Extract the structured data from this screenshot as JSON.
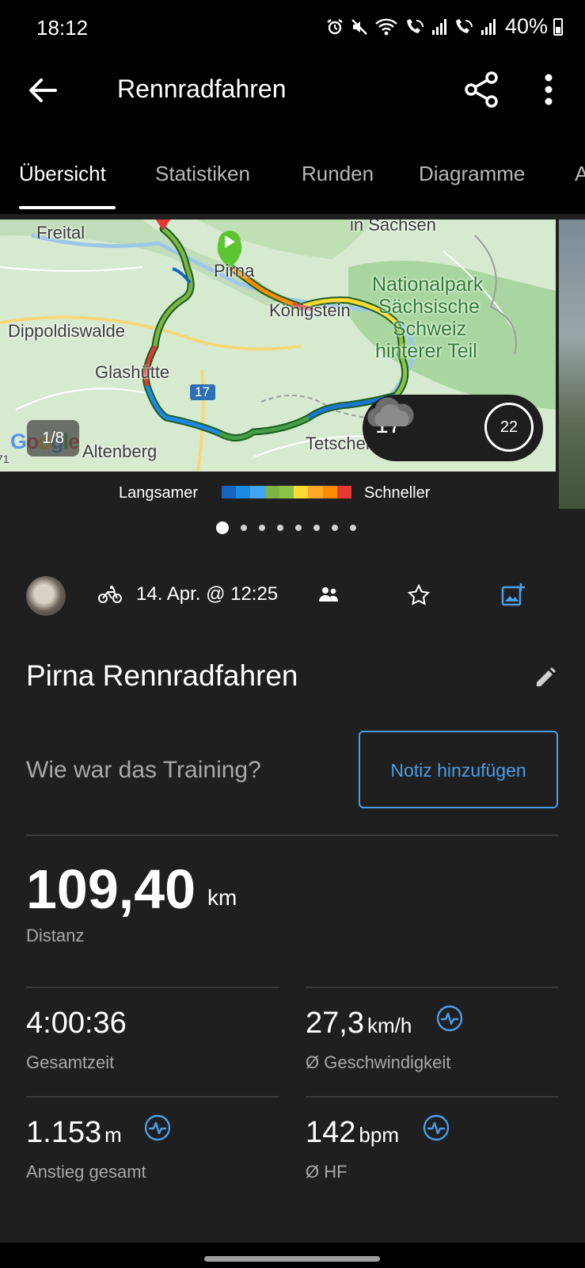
{
  "status_bar": {
    "time": "18:12",
    "battery": "40%"
  },
  "app_bar": {
    "title": "Rennradfahren"
  },
  "tabs": [
    {
      "label": "Übersicht",
      "active": true
    },
    {
      "label": "Statistiken"
    },
    {
      "label": "Runden"
    },
    {
      "label": "Diagramme"
    },
    {
      "label": "A"
    }
  ],
  "map": {
    "places": {
      "freital": "Freital",
      "sachsen": "in Sachsen",
      "pirna": "Pirna",
      "nationalpark": "Nationalpark",
      "saechsische": "Sächsische",
      "schweiz": "Schweiz",
      "hinterer": "hinterer Teil",
      "koenigstein": "Königstein",
      "dippoldiswalde": "Dippoldiswalde",
      "glashuette": "Glashütte",
      "altenberg": "Altenberg",
      "tetschen": "Tetschen",
      "route_number": "17",
      "edge_number": "71"
    },
    "google": "Google",
    "photo_counter": "1/8",
    "weather": {
      "temperature": "17°",
      "condition_icon": "cloud-icon",
      "wind": "22"
    },
    "legend": {
      "slower": "Langsamer",
      "faster": "Schneller",
      "colors": [
        "#1565c0",
        "#1e88e5",
        "#42a5f5",
        "#7cb342",
        "#8bc34a",
        "#fdd835",
        "#ffa726",
        "#fb8c00",
        "#e53935"
      ]
    }
  },
  "pager": {
    "count": 8,
    "active": 0
  },
  "activity": {
    "type_icon": "bike-icon",
    "date": "14. Apr. @ 12:25",
    "name": "Pirna Rennradfahren",
    "question": "Wie war das Training?",
    "note_button": "Notiz hinzufügen"
  },
  "stats": {
    "distance": {
      "value": "109,40",
      "unit": "km",
      "label": "Distanz"
    },
    "total_time": {
      "value": "4:00:36",
      "label": "Gesamtzeit"
    },
    "avg_speed": {
      "value": "27,3",
      "unit": "km/h",
      "label": "Ø Geschwindigkeit"
    },
    "ascent": {
      "value": "1.153",
      "unit": "m",
      "label": "Anstieg gesamt"
    },
    "avg_hr": {
      "value": "142",
      "unit": "bpm",
      "label": "Ø HF"
    }
  },
  "colors": {
    "accent": "#4a9eea",
    "background": "#1f1f1f",
    "bar": "#000000",
    "start_marker": "#5cc52f",
    "end_marker": "#e53935"
  }
}
